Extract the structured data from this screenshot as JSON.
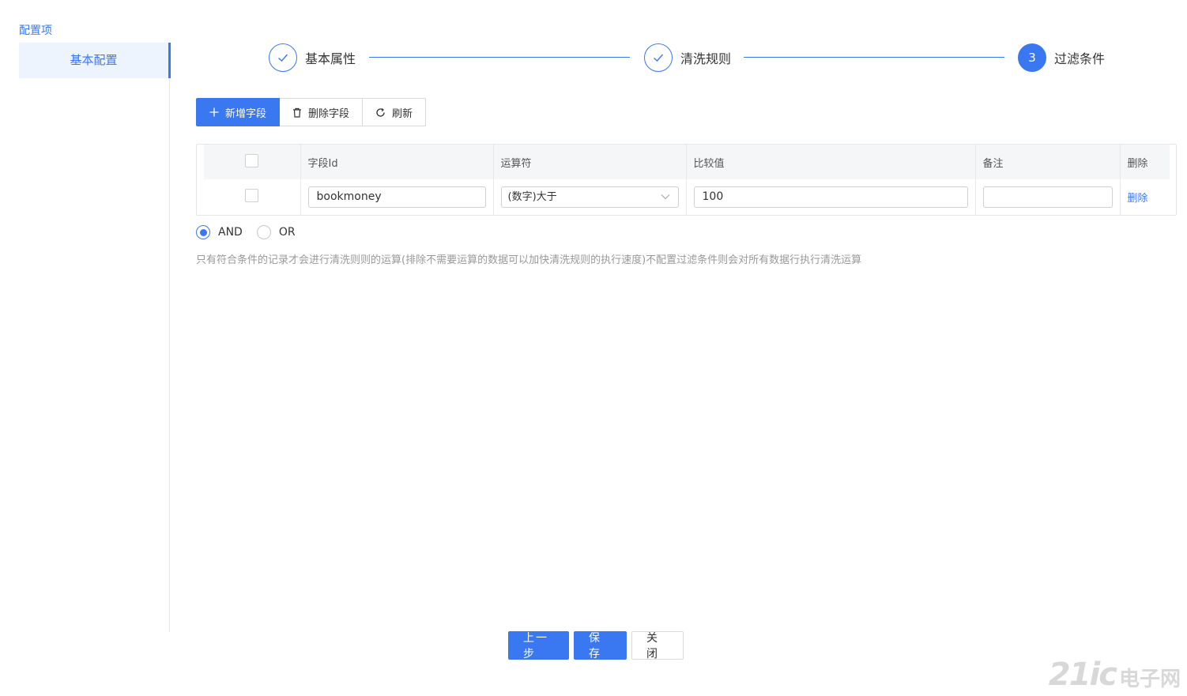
{
  "sidebar": {
    "title": "配置项",
    "items": [
      {
        "label": "基本配置"
      }
    ]
  },
  "steps": [
    {
      "label": "基本属性",
      "status": "done"
    },
    {
      "label": "清洗规则",
      "status": "done"
    },
    {
      "number": "3",
      "label": "过滤条件",
      "status": "active"
    }
  ],
  "toolbar": {
    "add_label": "新增字段",
    "delete_label": "删除字段",
    "refresh_label": "刷新"
  },
  "table": {
    "columns": [
      "字段Id",
      "运算符",
      "比较值",
      "备注",
      "删除"
    ],
    "rows": [
      {
        "field_id": "bookmoney",
        "operator": "(数字)大于",
        "compare_value": "100",
        "remark": "",
        "action": "删除"
      }
    ]
  },
  "logic": {
    "options": [
      "AND",
      "OR"
    ],
    "selected": "AND"
  },
  "hint": "只有符合条件的记录才会进行清洗则则的运算(排除不需要运算的数据可以加快清洗规则的执行速度)不配置过滤条件则会对所有数据行执行清洗运算",
  "footer": {
    "prev_label": "上一步",
    "save_label": "保存",
    "close_label": "关闭"
  },
  "watermark": {
    "num": "21ic",
    "text": "电子网"
  },
  "colors": {
    "primary": "#3a78f2",
    "muted": "#999999",
    "border": "#e5e7eb"
  }
}
